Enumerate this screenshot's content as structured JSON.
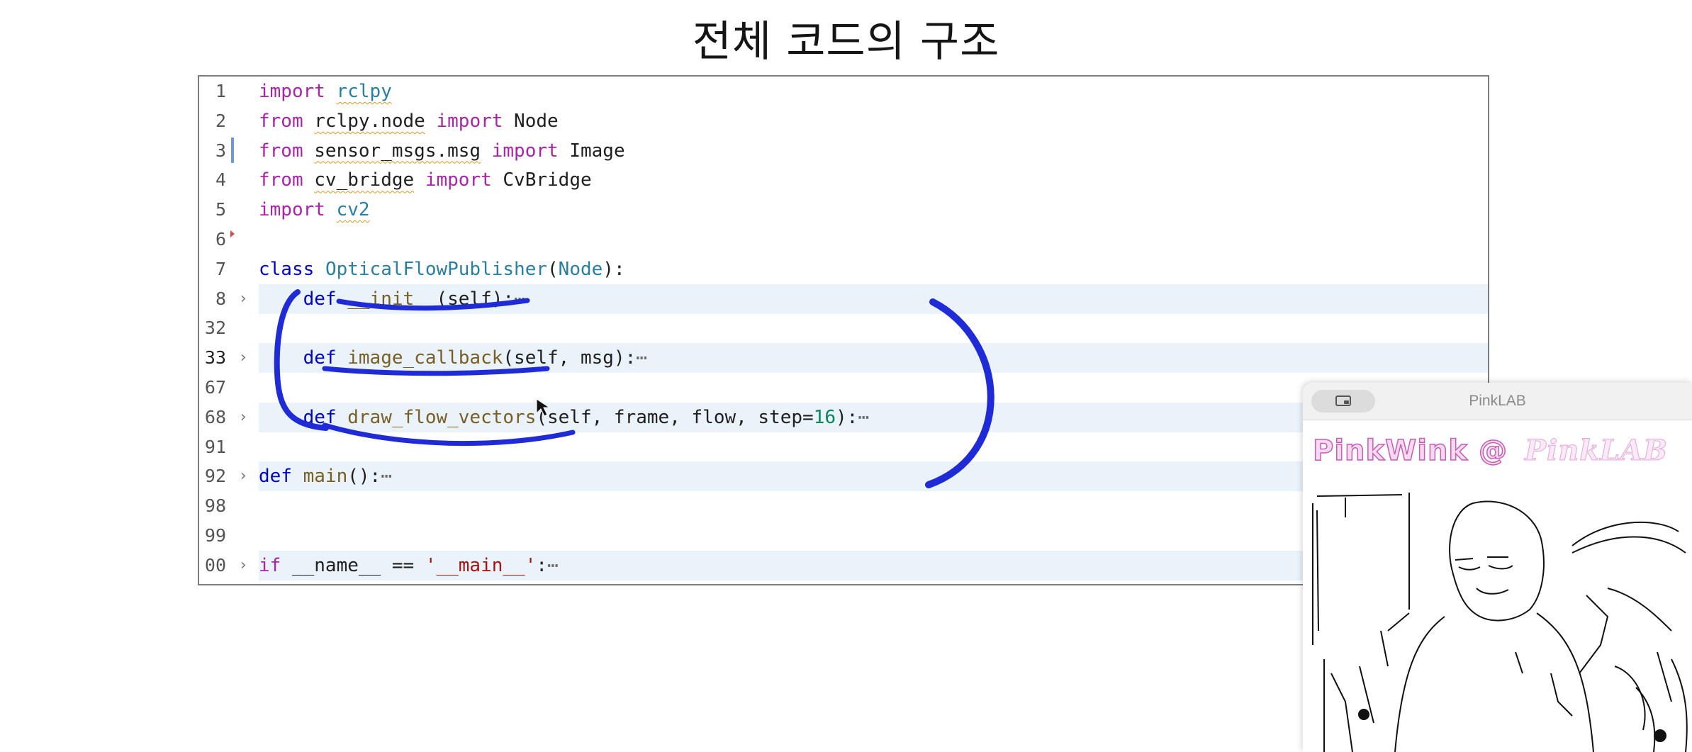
{
  "slide": {
    "title": "전체 코드의 구조"
  },
  "editor": {
    "lines": [
      {
        "n": "1",
        "fold": "",
        "tokens": [
          {
            "t": "import",
            "c": "kw"
          },
          {
            "t": " "
          },
          {
            "t": "rclpy",
            "c": "cls squig"
          }
        ]
      },
      {
        "n": "2",
        "fold": "",
        "tokens": [
          {
            "t": "from",
            "c": "kw"
          },
          {
            "t": " "
          },
          {
            "t": "rclpy.node",
            "c": "squig"
          },
          {
            "t": " "
          },
          {
            "t": "import",
            "c": "kw"
          },
          {
            "t": " Node"
          }
        ]
      },
      {
        "n": "3",
        "fold": "",
        "tokens": [
          {
            "t": "from",
            "c": "kw"
          },
          {
            "t": " "
          },
          {
            "t": "sensor_msgs.msg",
            "c": "squig"
          },
          {
            "t": " "
          },
          {
            "t": "import",
            "c": "kw"
          },
          {
            "t": " Image"
          }
        ]
      },
      {
        "n": "4",
        "fold": "",
        "tokens": [
          {
            "t": "from",
            "c": "kw"
          },
          {
            "t": " "
          },
          {
            "t": "cv_bridge",
            "c": "squig"
          },
          {
            "t": " "
          },
          {
            "t": "import",
            "c": "kw"
          },
          {
            "t": " CvBridge"
          }
        ]
      },
      {
        "n": "5",
        "fold": "",
        "tokens": [
          {
            "t": "import",
            "c": "kw"
          },
          {
            "t": " "
          },
          {
            "t": "cv2",
            "c": "cls squig"
          }
        ]
      },
      {
        "n": "6",
        "fold": "",
        "tokens": []
      },
      {
        "n": "7",
        "fold": "",
        "tokens": [
          {
            "t": "class",
            "c": "kw2"
          },
          {
            "t": " "
          },
          {
            "t": "OpticalFlowPublisher",
            "c": "cls"
          },
          {
            "t": "("
          },
          {
            "t": "Node",
            "c": "cls"
          },
          {
            "t": "):"
          }
        ]
      },
      {
        "n": "8",
        "fold": ">",
        "hl": true,
        "tokens": [
          {
            "t": "    "
          },
          {
            "t": "def",
            "c": "kw2"
          },
          {
            "t": " "
          },
          {
            "t": "__init__",
            "c": "fn"
          },
          {
            "t": "(self):"
          },
          {
            "t": "⋯",
            "c": "ellipsis"
          }
        ]
      },
      {
        "n": "32",
        "fold": "",
        "tokens": []
      },
      {
        "n": "33",
        "fold": ">",
        "hl": true,
        "active": true,
        "tokens": [
          {
            "t": "    "
          },
          {
            "t": "def",
            "c": "kw2"
          },
          {
            "t": " "
          },
          {
            "t": "image_callback",
            "c": "fn"
          },
          {
            "t": "(self, msg):"
          },
          {
            "t": "⋯",
            "c": "ellipsis"
          }
        ]
      },
      {
        "n": "67",
        "fold": "",
        "tokens": []
      },
      {
        "n": "68",
        "fold": ">",
        "hl": true,
        "tokens": [
          {
            "t": "    "
          },
          {
            "t": "def",
            "c": "kw2"
          },
          {
            "t": " "
          },
          {
            "t": "draw_flow_vectors",
            "c": "fn"
          },
          {
            "t": "(self, frame, flow, step="
          },
          {
            "t": "16",
            "c": "num"
          },
          {
            "t": "):"
          },
          {
            "t": "⋯",
            "c": "ellipsis"
          }
        ]
      },
      {
        "n": "91",
        "fold": "",
        "tokens": []
      },
      {
        "n": "92",
        "fold": ">",
        "hl": true,
        "tokens": [
          {
            "t": "def",
            "c": "kw2"
          },
          {
            "t": " "
          },
          {
            "t": "main",
            "c": "fn"
          },
          {
            "t": "():"
          },
          {
            "t": "⋯",
            "c": "ellipsis"
          }
        ]
      },
      {
        "n": "98",
        "fold": "",
        "tokens": []
      },
      {
        "n": "99",
        "fold": "",
        "tokens": []
      },
      {
        "n": "00",
        "fold": ">",
        "hl": true,
        "tokens": [
          {
            "t": "if",
            "c": "kw"
          },
          {
            "t": " __name__ == "
          },
          {
            "t": "'__main__'",
            "c": "str"
          },
          {
            "t": ":"
          },
          {
            "t": "⋯",
            "c": "ellipsis"
          }
        ]
      }
    ]
  },
  "webcam": {
    "window_title": "PinkLAB",
    "brand_main": "PinkWink @",
    "brand_faint": "PinkLAB"
  },
  "colors": {
    "annotation_pen": "#1f2bd6",
    "fold_highlight": "#eaf2fa",
    "brand_pink": "#c35fb4"
  }
}
